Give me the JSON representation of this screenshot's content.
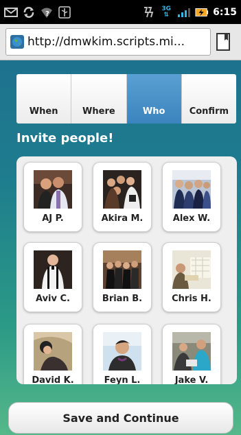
{
  "status_bar": {
    "time": "6:15",
    "network": "3G",
    "icons": [
      "mail-icon",
      "sync-icon",
      "wifi-question-icon",
      "usb-icon",
      "vibrate-icon",
      "3g-icon",
      "signal-icon",
      "battery-charging-icon"
    ]
  },
  "browser": {
    "url": "http://dmwkim.scripts.mi..."
  },
  "tabs": [
    {
      "label": "When",
      "active": false
    },
    {
      "label": "Where",
      "active": false
    },
    {
      "label": "Who",
      "active": true
    },
    {
      "label": "Confirm",
      "active": false
    }
  ],
  "heading": "Invite people!",
  "people": [
    {
      "name": "AJ P."
    },
    {
      "name": "Akira M."
    },
    {
      "name": "Alex W."
    },
    {
      "name": "Aviv C."
    },
    {
      "name": "Brian B."
    },
    {
      "name": "Chris H."
    },
    {
      "name": "David K."
    },
    {
      "name": "Feyn L."
    },
    {
      "name": "Jake V."
    }
  ],
  "save_button": "Save and Continue",
  "colors": {
    "active_tab": "#4a93c9",
    "background_top": "#1d6d8d",
    "background_bottom": "#56b88a"
  }
}
